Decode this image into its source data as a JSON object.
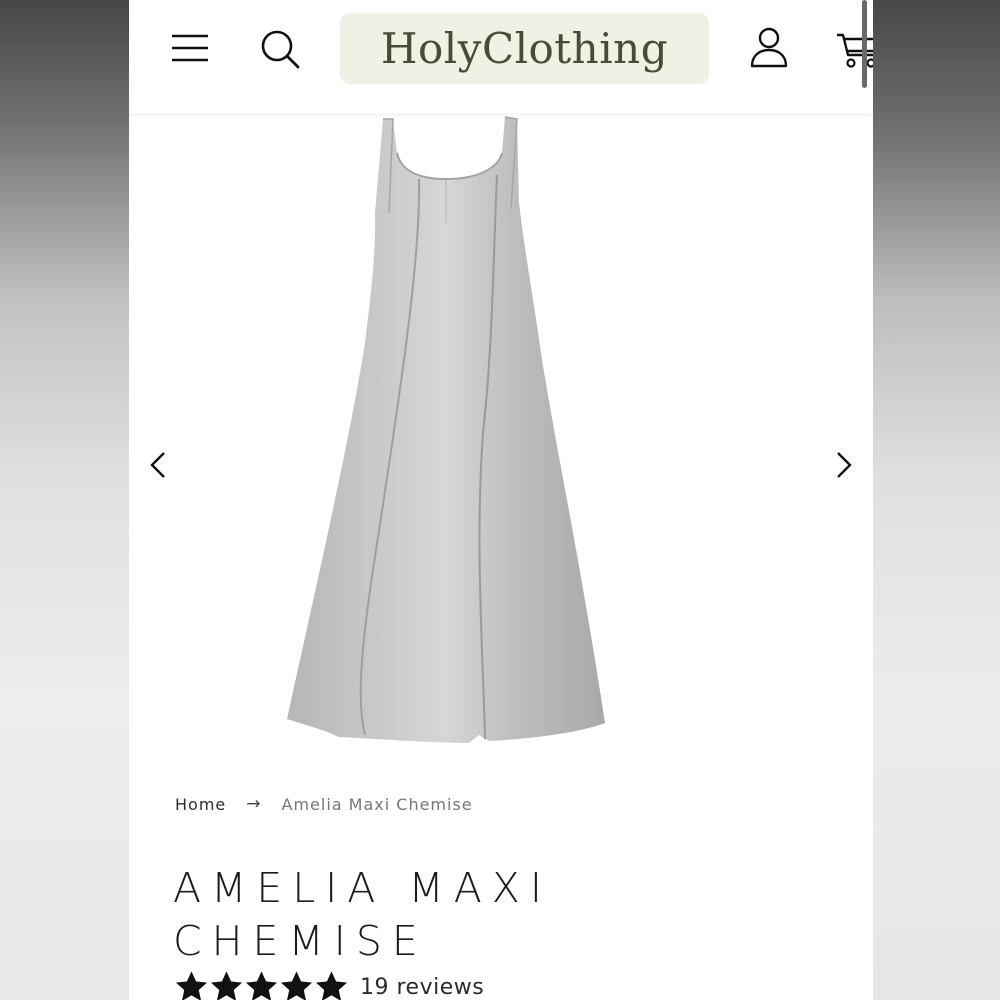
{
  "header": {
    "logo_text": "HolyClothing",
    "icons": {
      "menu": "hamburger-menu-icon",
      "search": "search-icon",
      "account": "user-account-icon",
      "cart": "shopping-cart-icon"
    }
  },
  "gallery": {
    "image": "grey-sleeveless-maxi-dress",
    "prev_icon": "chevron-left-icon",
    "next_icon": "chevron-right-icon"
  },
  "breadcrumb": {
    "home": "Home",
    "separator": "→",
    "current": "Amelia Maxi Chemise"
  },
  "product": {
    "title_line1": "AMELIA MAXI",
    "title_line2": "CHEMISE",
    "rating": 5,
    "rating_max": 5,
    "reviews_label": "19 reviews"
  },
  "colors": {
    "logo_background": "#eef1e4",
    "logo_text": "#4a4b34",
    "dress": "#c2c2c2"
  }
}
